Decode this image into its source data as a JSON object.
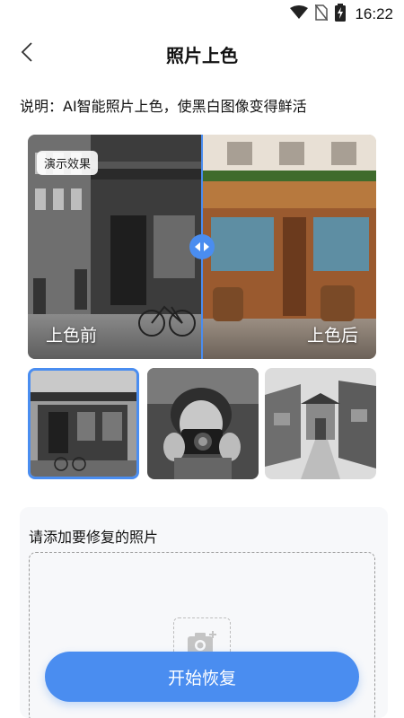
{
  "status_bar": {
    "time": "16:22",
    "icons": [
      "wifi-icon",
      "no-sim-icon",
      "battery-charging-icon"
    ]
  },
  "nav": {
    "title": "照片上色",
    "back_icon": "chevron-left-icon"
  },
  "description": "说明：AI智能照片上色，使黑白图像变得鲜活",
  "compare": {
    "badge": "演示效果",
    "before_label": "上色前",
    "after_label": "上色后",
    "handle_icon": "drag-handle-icon"
  },
  "samples": [
    {
      "name": "street-corner-photo",
      "selected": true
    },
    {
      "name": "girl-with-camera-photo",
      "selected": false
    },
    {
      "name": "old-town-street-photo",
      "selected": false
    }
  ],
  "upload": {
    "title": "请添加要修复的照片",
    "icon": "add-photo-camera-icon"
  },
  "start_button": "开始恢复",
  "colors": {
    "accent": "#4a8df0",
    "card_bg": "#f7f8fa"
  }
}
